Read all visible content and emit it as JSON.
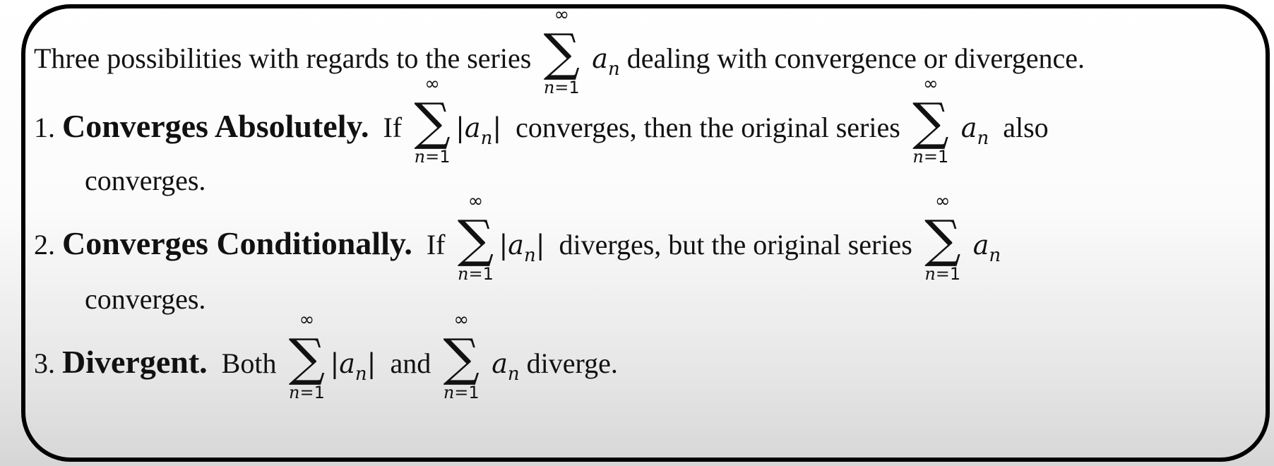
{
  "intro": {
    "before": "Three possibilities with regards to the series",
    "after": "dealing with convergence or divergence."
  },
  "math": {
    "sum_upper": "∞",
    "sum_lower_var": "n=",
    "sum_lower_val": "1",
    "sigma": "∑",
    "term_base": "a",
    "term_sub": "n",
    "abs_bar": "|"
  },
  "items": [
    {
      "number": "1.",
      "heading": "Converges Absolutely.",
      "text_if": "If",
      "text_mid": "converges, then the original series",
      "text_end": "also",
      "continuation": "converges."
    },
    {
      "number": "2.",
      "heading": "Converges Conditionally.",
      "text_if": "If",
      "text_mid": "diverges, but the original series",
      "continuation": "converges."
    },
    {
      "number": "3.",
      "heading": "Divergent.",
      "text_both": "Both",
      "text_and": "and",
      "text_end": "diverge."
    }
  ]
}
